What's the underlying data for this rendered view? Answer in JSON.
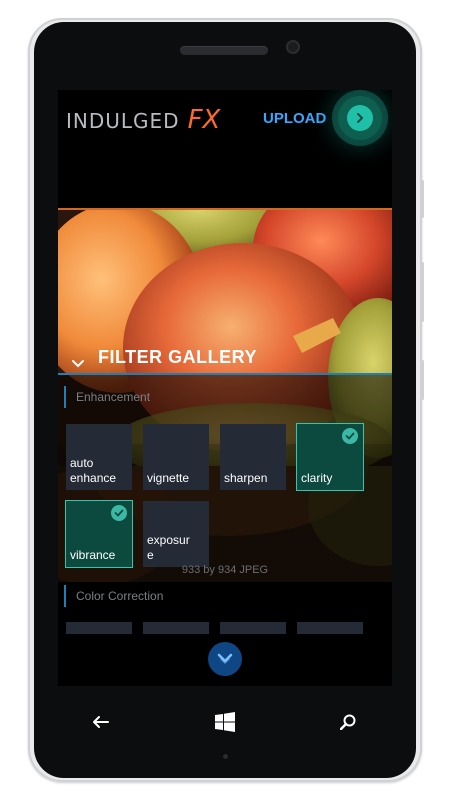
{
  "app": {
    "logo_text": "INDULGED",
    "logo_accent": "FX",
    "upload_label": "UPLOAD"
  },
  "gallery": {
    "title": "FILTER GALLERY",
    "file_info": "933 by 934 JPEG"
  },
  "sections": [
    {
      "label": "Enhancement",
      "filters": [
        {
          "label": "auto enhance",
          "selected": false
        },
        {
          "label": "vignette",
          "selected": false
        },
        {
          "label": "sharpen",
          "selected": false
        },
        {
          "label": "clarity",
          "selected": true
        },
        {
          "label": "vibrance",
          "selected": true
        },
        {
          "label": "exposure",
          "selected": false
        }
      ]
    },
    {
      "label": "Color Correction",
      "filters": []
    }
  ],
  "colors": {
    "accent_orange": "#ff6a2a",
    "accent_blue": "#38a7ff",
    "accent_teal": "#35c4ad",
    "tile_bg": "#242a36"
  },
  "icons": {
    "back": "back-arrow-icon",
    "home": "windows-logo-icon",
    "search": "search-icon",
    "collapse": "chevron-down-icon",
    "scroll": "chevron-down-icon",
    "upload": "arrow-right-icon",
    "check": "checkmark-icon"
  }
}
